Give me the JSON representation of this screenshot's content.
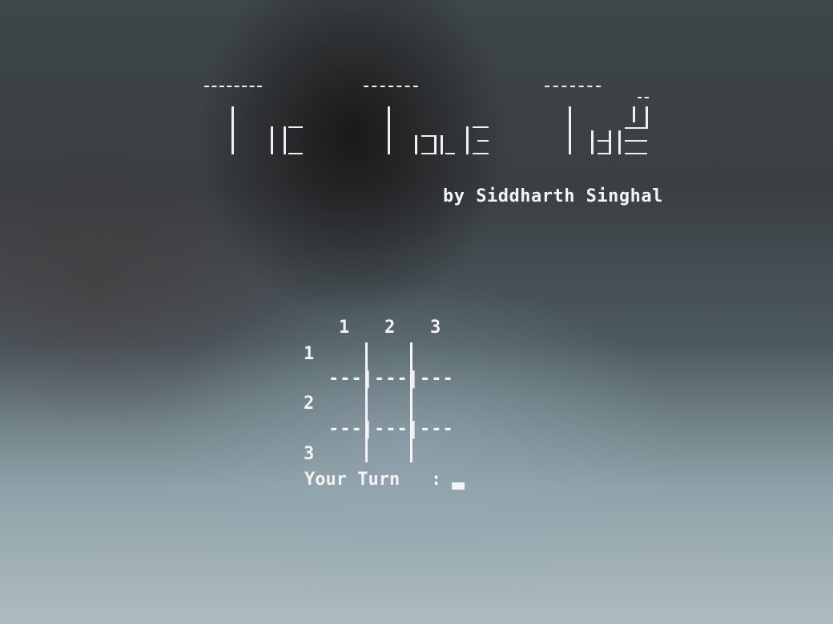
{
  "app": {
    "title": "Tic Tac Toe",
    "author_line": "by Siddharth Singhal"
  },
  "board": {
    "column_labels": [
      "1",
      "2",
      "3"
    ],
    "row_labels": [
      "1",
      "2",
      "3"
    ],
    "separator_row": "---|---|---",
    "cells": [
      [
        "",
        "",
        ""
      ],
      [
        "",
        "",
        ""
      ],
      [
        "",
        "",
        ""
      ]
    ]
  },
  "prompt": {
    "label": "Your Turn",
    "separator": ":",
    "input_value": ""
  }
}
